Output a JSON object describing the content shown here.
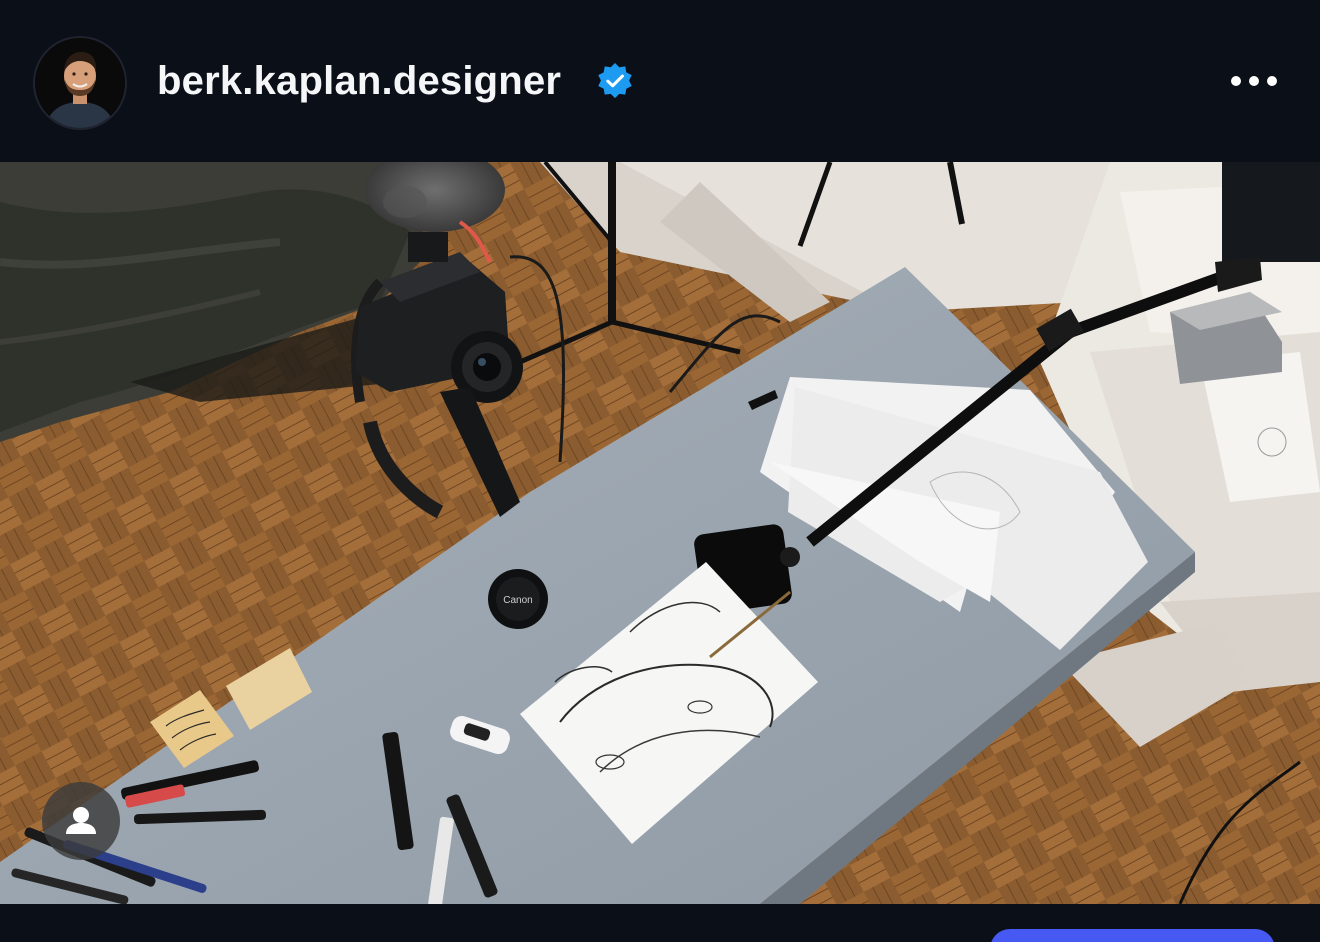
{
  "post": {
    "username": "berk.kaplan.designer",
    "verified": true
  },
  "photo": {
    "lens_cap_text": "Canon"
  },
  "colors": {
    "background": "#0b0f17",
    "username_text": "#f5f6f8",
    "verified_badge": "#1d9bf0",
    "follow_button": "#4759f3",
    "tag_button": "#3c3c3c"
  },
  "icons": {
    "more": "more-horizontal-icon",
    "verified": "verified-badge-icon",
    "tags": "user-tag-icon"
  }
}
